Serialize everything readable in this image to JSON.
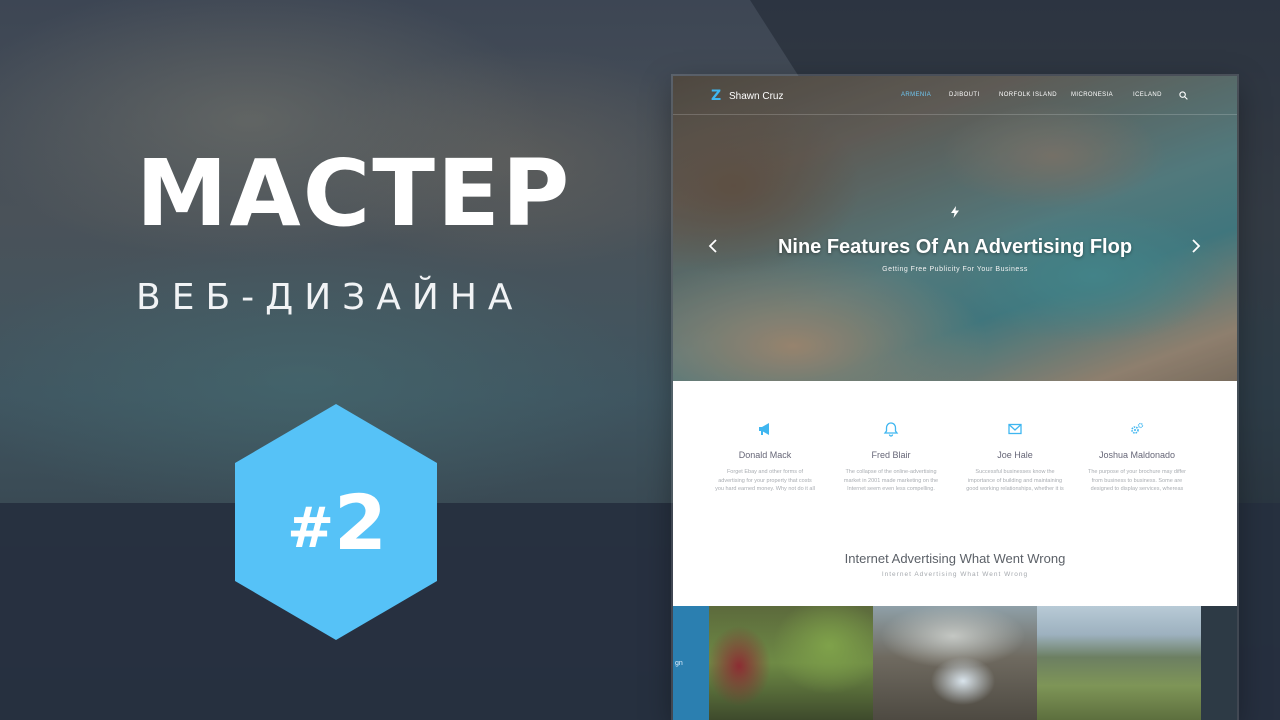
{
  "banner": {
    "title": "МАСТЕР",
    "subtitle": "ВЕБ-ДИЗАЙНА",
    "badge_hash": "#",
    "badge_number": "2",
    "badge_color": "#56c2f7"
  },
  "mockup": {
    "nav": {
      "logo_icon": "Z",
      "brand": "Shawn Cruz",
      "items": [
        "ARMENIA",
        "DJIBOUTI",
        "NORFOLK ISLAND",
        "MICRONESIA",
        "ICELAND"
      ],
      "active_index": 0,
      "search_icon": "search-icon"
    },
    "hero": {
      "icon": "bolt-icon",
      "title": "Nine Features Of An Advertising Flop",
      "subtitle": "Getting Free Publicity For Your Business"
    },
    "features": [
      {
        "icon": "megaphone-icon",
        "name": "Donald Mack",
        "lines": [
          "Forget Ebay and other forms of",
          "advertising for your property that costs",
          "you hard earned money. Why not do it all"
        ]
      },
      {
        "icon": "bell-icon",
        "name": "Fred Blair",
        "lines": [
          "The collapse of the online-advertising",
          "market in 2001 made marketing on the",
          "Internet seem even less compelling."
        ]
      },
      {
        "icon": "envelope-icon",
        "name": "Joe Hale",
        "lines": [
          "Successful businesses know the",
          "importance of building and maintaining",
          "good working relationships, whether it is"
        ]
      },
      {
        "icon": "gears-icon",
        "name": "Joshua Maldonado",
        "lines": [
          "The purpose of your brochure may differ",
          "from business to business. Some are",
          "designed to display services, whereas"
        ]
      }
    ],
    "section": {
      "title": "Internet Advertising What Went Wrong",
      "subtitle": "Internet Advertising What Went Wrong"
    },
    "gallery_partial_text": "gn"
  }
}
